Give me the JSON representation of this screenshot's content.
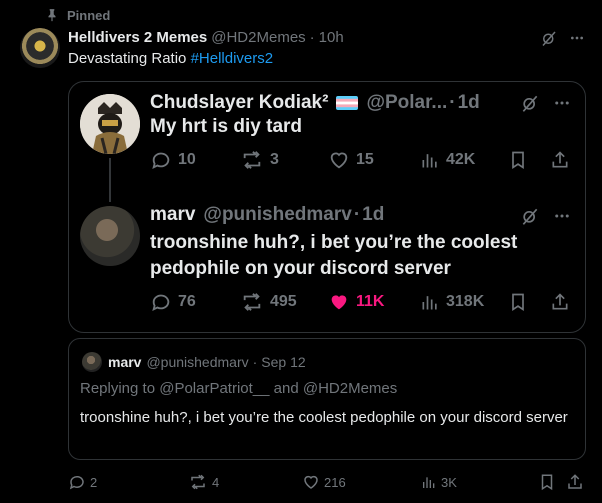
{
  "pinned": {
    "label": "Pinned"
  },
  "main": {
    "author_name": "Helldivers 2 Memes",
    "author_handle": "@HD2Memes",
    "separator": "·",
    "time": "10h",
    "text_prefix": "Devastating Ratio",
    "hashtag": "#Helldivers2"
  },
  "card": {
    "reply1": {
      "name": "Chudslayer Kodiak²",
      "flag": "trans-flag",
      "handle": "@Polar...",
      "separator": "·",
      "time": "1d",
      "text": "My hrt is diy tard",
      "actions": {
        "replies": "10",
        "reposts": "3",
        "likes": "15",
        "views": "42K"
      }
    },
    "reply2": {
      "name": "marv",
      "handle": "@punishedmarv",
      "separator": "·",
      "time": "1d",
      "text_line1": "troonshine huh?, i bet you’re the coolest",
      "text_line2": "pedophile on your discord server",
      "actions": {
        "replies": "76",
        "reposts": "495",
        "likes": "11K",
        "views": "318K"
      }
    }
  },
  "quote": {
    "name": "marv",
    "handle": "@punishedmarv",
    "separator": "·",
    "date": "Sep 12",
    "replying_to": "Replying to @PolarPatriot__ and @HD2Memes",
    "text": "troonshine huh?, i bet you’re the coolest pedophile on your discord server"
  },
  "bottom_actions": {
    "replies": "2",
    "reposts": "4",
    "likes": "216",
    "views": "3K"
  },
  "colors": {
    "background": "#000000",
    "text": "#e7e9ea",
    "muted": "#71767b",
    "link": "#1d9bf0",
    "like": "#f91880",
    "border": "#2f3336"
  }
}
